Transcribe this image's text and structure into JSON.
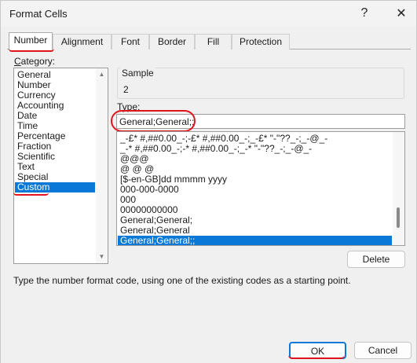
{
  "window": {
    "title": "Format Cells",
    "help_glyph": "?",
    "close_glyph": "✕"
  },
  "tabs": [
    {
      "label": "Number",
      "active": true
    },
    {
      "label": "Alignment",
      "active": false
    },
    {
      "label": "Font",
      "active": false
    },
    {
      "label": "Border",
      "active": false
    },
    {
      "label": "Fill",
      "active": false
    },
    {
      "label": "Protection",
      "active": false
    }
  ],
  "category": {
    "label_first": "C",
    "label_rest": "ategory:",
    "items": [
      "General",
      "Number",
      "Currency",
      "Accounting",
      "Date",
      "Time",
      "Percentage",
      "Fraction",
      "Scientific",
      "Text",
      "Special",
      "Custom"
    ],
    "selected": "Custom"
  },
  "sample": {
    "label": "Sample",
    "value": "2"
  },
  "type": {
    "label": "Type:",
    "value": "General;General;;"
  },
  "formats": {
    "items": [
      "_-£* #,##0.00_-;-£* #,##0.00_-;_-£* \"-\"??_-;_-@_-",
      "_-* #,##0.00_-;-* #,##0.00_-;_-* \"-\"??_-;_-@_-",
      "@@@",
      "@ @ @",
      "[$-en-GB]dd mmmm yyyy",
      "000-000-0000",
      "000",
      "00000000000",
      "General;General;",
      "General;General",
      "General;General;;"
    ],
    "selected_index": 10
  },
  "buttons": {
    "delete": "Delete",
    "ok": "OK",
    "cancel": "Cancel"
  },
  "hint": "Type the number format code, using one of the existing codes as a starting point.",
  "colors": {
    "accent": "#0a78d7",
    "annotation_red": "#e0141c"
  }
}
